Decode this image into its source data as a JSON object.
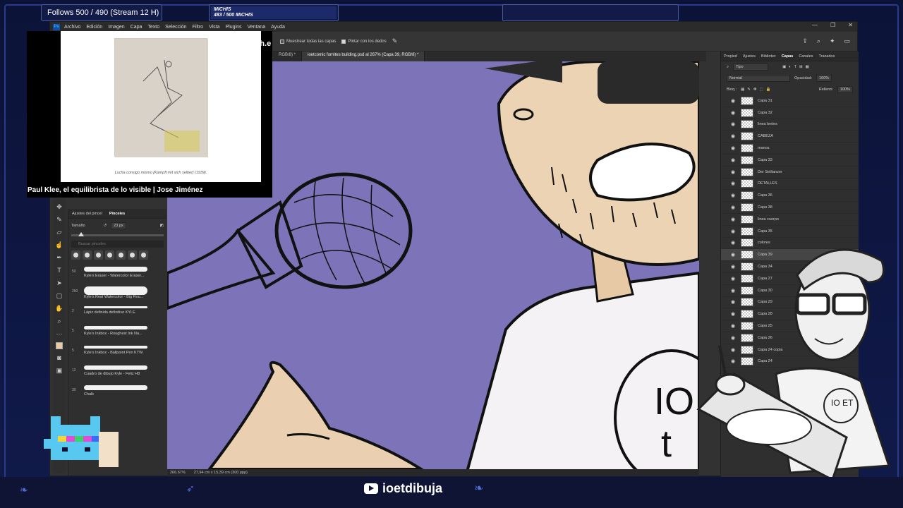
{
  "menubar": {
    "items": [
      "Archivo",
      "Edición",
      "Imagen",
      "Capa",
      "Texto",
      "Selección",
      "Filtro",
      "Vista",
      "Plugins",
      "Ventana",
      "Ayuda"
    ],
    "window_controls": [
      "—",
      "❐",
      "✕"
    ]
  },
  "options_bar": {
    "sample_all_layers": "Muestrear todas las capas",
    "finger_painting": "Pintar con los dedos"
  },
  "tabs": [
    {
      "label": "RGB/8) *",
      "active": false
    },
    {
      "label": "ioetcomic fornites building.psd al 267% (Capa 39, RGB/8) *",
      "active": true
    }
  ],
  "brush_panel": {
    "tabs": [
      "Ajustes del pincel",
      "Pinceles"
    ],
    "size_label": "Tamaño",
    "size_value": "23 px",
    "search_placeholder": "Buscar pinceles",
    "brushes": [
      {
        "size": "50",
        "name": "Kyle's Eraser - Watercolor Eraser..."
      },
      {
        "size": "250",
        "name": "Kyle's Real Watercolor - Big Rou..."
      },
      {
        "size": "2",
        "name": "Lápiz definido definitivo KYLE"
      },
      {
        "size": "5",
        "name": "Kyle's Inkbox - Roughest Ink Na..."
      },
      {
        "size": "5",
        "name": "Kyle's Inkbox - Ballpoint Pen KTW"
      },
      {
        "size": "12",
        "name": "Cuadro de dibujo Kyle - Feliz H8"
      },
      {
        "size": "30",
        "name": "Chalk"
      }
    ]
  },
  "status_bar": {
    "zoom": "266.67%",
    "doc_size": "27,94 cm x 15,39 cm (300 ppp)"
  },
  "layers_panel": {
    "tabs": [
      "Propied",
      "Ajustes",
      "Bibliotec",
      "Capas",
      "Canales",
      "Trazados"
    ],
    "active_tab": "Capas",
    "filter_label": "Tipo",
    "blend_mode": "Normal",
    "opacity_label": "Opacidad:",
    "opacity_value": "100%",
    "lock_label": "Bloq.:",
    "fill_label": "Relleno:",
    "fill_value": "100%",
    "layers": [
      {
        "name": "Capa 31",
        "selected": false
      },
      {
        "name": "Capa 32",
        "selected": false
      },
      {
        "name": "linea lentes",
        "selected": false
      },
      {
        "name": "CABEZA",
        "selected": false
      },
      {
        "name": "manos",
        "selected": false
      },
      {
        "name": "Capa 33",
        "selected": false
      },
      {
        "name": "Der Seiltanzer",
        "selected": false
      },
      {
        "name": "DETALLES",
        "selected": false
      },
      {
        "name": "Capa 36",
        "selected": false
      },
      {
        "name": "Capa 38",
        "selected": false
      },
      {
        "name": "linea cuerpo",
        "selected": false
      },
      {
        "name": "Capa 35",
        "selected": false
      },
      {
        "name": "colores",
        "selected": false
      },
      {
        "name": "Capa 39",
        "selected": true
      },
      {
        "name": "Capa 34",
        "selected": false
      },
      {
        "name": "Capa 27",
        "selected": false
      },
      {
        "name": "Capa 30",
        "selected": false
      },
      {
        "name": "Capa 29",
        "selected": false
      },
      {
        "name": "Capa 28",
        "selected": false
      },
      {
        "name": "Capa 25",
        "selected": false
      },
      {
        "name": "Capa 26",
        "selected": false
      },
      {
        "name": "Capa 24 copia",
        "selected": false
      },
      {
        "name": "Capa 24",
        "selected": false
      }
    ]
  },
  "video": {
    "caption": "Lucha consigo mismo [Kampft mit sich selber] (1939).",
    "title": "Paul Klee, el equilibrista de lo visible | Jose Jiménez",
    "corner_text": "march.e"
  },
  "stream_overlay": {
    "follows": "Follows 500 / 490 (Stream 12 H)",
    "michis_title": "MICHIS",
    "michis_count": "483 / 500 MICHIS",
    "youtube_handle": "ioetdibuja"
  },
  "avatar_shirt_text": "IO ET",
  "colors": {
    "canvas": "#7c73b8",
    "ps_panel": "#2f2f2f",
    "overlay_bg": "#0f1435",
    "skin": "#e8c9a6"
  }
}
